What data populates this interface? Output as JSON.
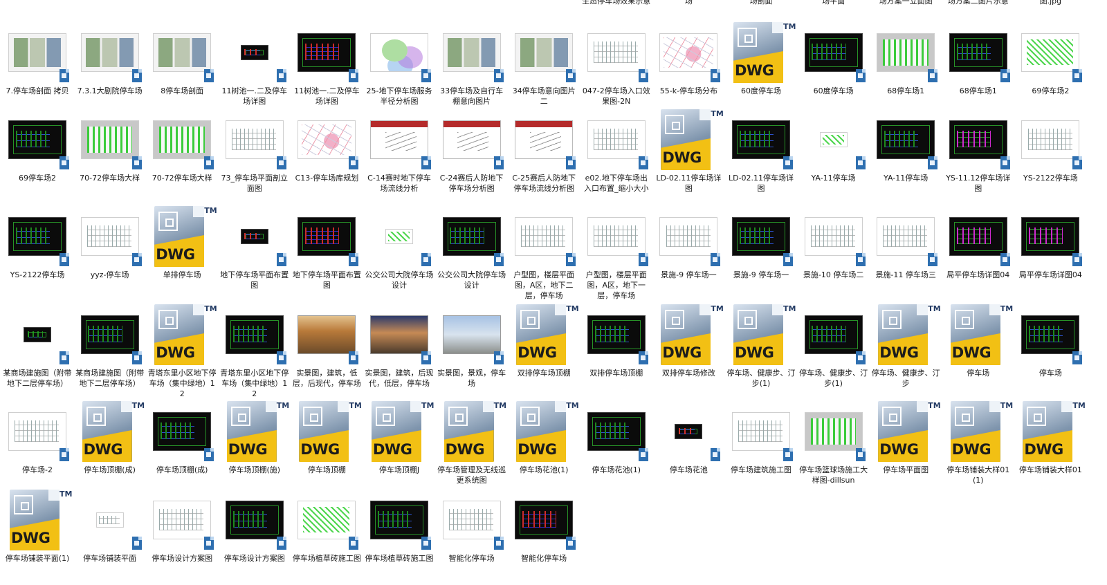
{
  "top_row_partial": [
    {
      "label": "生态停车场效果示意",
      "col": 8
    },
    {
      "label": "场",
      "col": 9
    },
    {
      "label": "场剖面",
      "col": 10
    },
    {
      "label": "场平面",
      "col": 11
    },
    {
      "label": "场方案一立面图",
      "col": 12
    },
    {
      "label": "场方案二图片示意",
      "col": 13
    },
    {
      "label": "图.jpg",
      "col": 14
    }
  ],
  "rows": [
    [
      {
        "label": "7.停车场剖面 拷贝",
        "type": "img",
        "style": "board"
      },
      {
        "label": "7.3.1大剧院停车场",
        "type": "img",
        "style": "board"
      },
      {
        "label": "8停车场剖面",
        "type": "img",
        "style": "board"
      },
      {
        "label": "11树池一.二及停车场详图",
        "type": "tiny",
        "style": "cad red"
      },
      {
        "label": "11树池一.二及停车场详图",
        "type": "img",
        "style": "cad red"
      },
      {
        "label": "25-地下停车场服务半径分析图",
        "type": "img",
        "style": "venn"
      },
      {
        "label": "33停车场及自行车棚意向图片",
        "type": "img",
        "style": "board"
      },
      {
        "label": "34停车场意向图片二",
        "type": "img",
        "style": "board"
      },
      {
        "label": "047-2停车场入口效果图-2N",
        "type": "img",
        "style": "draw"
      },
      {
        "label": "55-k-停车场分布",
        "type": "img",
        "style": "plan"
      },
      {
        "label": "60度停车场",
        "type": "dwg"
      },
      {
        "label": "60度停车场",
        "type": "img",
        "style": "cad"
      },
      {
        "label": "68停车场1",
        "type": "img",
        "style": "grey"
      },
      {
        "label": "68停车场1",
        "type": "img",
        "style": "cad"
      },
      {
        "label": "69停车场2",
        "type": "img",
        "style": "greendraw"
      }
    ],
    [
      {
        "label": "69停车场2",
        "type": "img",
        "style": "cad"
      },
      {
        "label": "70-72停车场大样",
        "type": "img",
        "style": "grey"
      },
      {
        "label": "70-72停车场大样",
        "type": "img",
        "style": "grey"
      },
      {
        "label": "73_停车场平面剖立面图",
        "type": "img",
        "style": "draw"
      },
      {
        "label": "C13-停车场库规划",
        "type": "img",
        "style": "plan"
      },
      {
        "label": "C-14赛时地下停车场流线分析",
        "type": "img",
        "style": "slide"
      },
      {
        "label": "C-24赛后人防地下停车场分析图",
        "type": "img",
        "style": "slide"
      },
      {
        "label": "C-25赛后人防地下停车场流线分析图",
        "type": "img",
        "style": "slide"
      },
      {
        "label": "e02.地下停车场出入口布置_缩小大小",
        "type": "img",
        "style": "draw"
      },
      {
        "label": "LD-02.11停车场详图",
        "type": "dwg"
      },
      {
        "label": "LD-02.11停车场详图",
        "type": "img",
        "style": "cad"
      },
      {
        "label": "YA-11停车场",
        "type": "tiny",
        "style": "greendraw"
      },
      {
        "label": "YA-11停车场",
        "type": "img",
        "style": "cad"
      },
      {
        "label": "YS-11.12停车场详图",
        "type": "img",
        "style": "cad mag"
      },
      {
        "label": "YS-2122停车场",
        "type": "img",
        "style": "draw"
      }
    ],
    [
      {
        "label": "YS-2122停车场",
        "type": "img",
        "style": "cad"
      },
      {
        "label": "yyz-停车场",
        "type": "img",
        "style": "draw"
      },
      {
        "label": "单排停车场",
        "type": "dwg"
      },
      {
        "label": "地下停车场平面布置图",
        "type": "tiny",
        "style": "cad red"
      },
      {
        "label": "地下停车场平面布置图",
        "type": "img",
        "style": "cad red"
      },
      {
        "label": "公交公司大院停车场设计",
        "type": "tiny",
        "style": "greendraw"
      },
      {
        "label": "公交公司大院停车场设计",
        "type": "img",
        "style": "cad"
      },
      {
        "label": "户型图，楼层平面图，A区，地下二层，停车场",
        "type": "img",
        "style": "draw"
      },
      {
        "label": "户型图，楼层平面图，A区，地下一层，停车场",
        "type": "img",
        "style": "draw"
      },
      {
        "label": "景施-9 停车场一",
        "type": "img",
        "style": "draw"
      },
      {
        "label": "景施-9 停车场一",
        "type": "img",
        "style": "cad"
      },
      {
        "label": "景施-10 停车场二",
        "type": "img",
        "style": "draw"
      },
      {
        "label": "景施-11 停车场三",
        "type": "img",
        "style": "draw"
      },
      {
        "label": "局平停车场详图04",
        "type": "img",
        "style": "cad mag"
      },
      {
        "label": "局平停车场详图04",
        "type": "img",
        "style": "cad mag"
      }
    ],
    [
      {
        "label": "某商场建施图（附带地下二层停车场）",
        "type": "tiny",
        "style": "cad"
      },
      {
        "label": "某商场建施图（附带地下二层停车场）",
        "type": "img",
        "style": "cad"
      },
      {
        "label": "青塔东里小区地下停车场（集中绿地）12",
        "type": "dwg"
      },
      {
        "label": "青塔东里小区地下停车场（集中绿地）12",
        "type": "img",
        "style": "cad"
      },
      {
        "label": "实景图，建筑，低层，后现代，停车场",
        "type": "img",
        "style": "photo orange"
      },
      {
        "label": "实景图，建筑，后现代，低层，停车场",
        "type": "img",
        "style": "photo dusk"
      },
      {
        "label": "实景图，景观，停车场",
        "type": "img",
        "style": "photo sign"
      },
      {
        "label": "双排停车场顶棚",
        "type": "dwg"
      },
      {
        "label": "双排停车场顶棚",
        "type": "img",
        "style": "cad"
      },
      {
        "label": "双排停车场修改",
        "type": "dwg"
      },
      {
        "label": "停车场、健康步、汀步(1)",
        "type": "dwg"
      },
      {
        "label": "停车场、健康步、汀步(1)",
        "type": "img",
        "style": "cad"
      },
      {
        "label": "停车场、健康步、汀步",
        "type": "dwg"
      },
      {
        "label": "停车场",
        "type": "dwg"
      },
      {
        "label": "停车场",
        "type": "img",
        "style": "cad"
      }
    ],
    [
      {
        "label": "停车场-2",
        "type": "img",
        "style": "draw"
      },
      {
        "label": "停车场顶棚(成)",
        "type": "dwg"
      },
      {
        "label": "停车场顶棚(成)",
        "type": "img",
        "style": "cad"
      },
      {
        "label": "停车场顶棚(施)",
        "type": "dwg"
      },
      {
        "label": "停车场顶棚",
        "type": "dwg"
      },
      {
        "label": "停车场顶棚J",
        "type": "dwg"
      },
      {
        "label": "停车场管理及无线巡更系统图",
        "type": "dwg"
      },
      {
        "label": "停车场花池(1)",
        "type": "dwg"
      },
      {
        "label": "停车场花池(1)",
        "type": "img",
        "style": "cad"
      },
      {
        "label": "停车场花池",
        "type": "tiny",
        "style": "cad red"
      },
      {
        "label": "停车场建筑施工图",
        "type": "img",
        "style": "draw"
      },
      {
        "label": "停车场篮球场施工大样图-dillsun",
        "type": "img",
        "style": "grey"
      },
      {
        "label": "停车场平面图",
        "type": "dwg"
      },
      {
        "label": "停车场铺装大样01(1)",
        "type": "dwg"
      },
      {
        "label": "停车场铺装大样01",
        "type": "dwg"
      }
    ],
    [
      {
        "label": "停车场铺装平面(1)",
        "type": "dwg"
      },
      {
        "label": "停车场铺装平面",
        "type": "tiny",
        "style": "draw"
      },
      {
        "label": "停车场设计方案图",
        "type": "img",
        "style": "draw"
      },
      {
        "label": "停车场设计方案图",
        "type": "img",
        "style": "cad"
      },
      {
        "label": "停车场植草砖施工图",
        "type": "img",
        "style": "greendraw"
      },
      {
        "label": "停车场植草砖施工图",
        "type": "img",
        "style": "cad"
      },
      {
        "label": "智能化停车场",
        "type": "img",
        "style": "draw"
      },
      {
        "label": "智能化停车场",
        "type": "img",
        "style": "cad red"
      }
    ]
  ],
  "icons": {
    "dwg_text": "DWG",
    "dwg_tm": "TM"
  }
}
